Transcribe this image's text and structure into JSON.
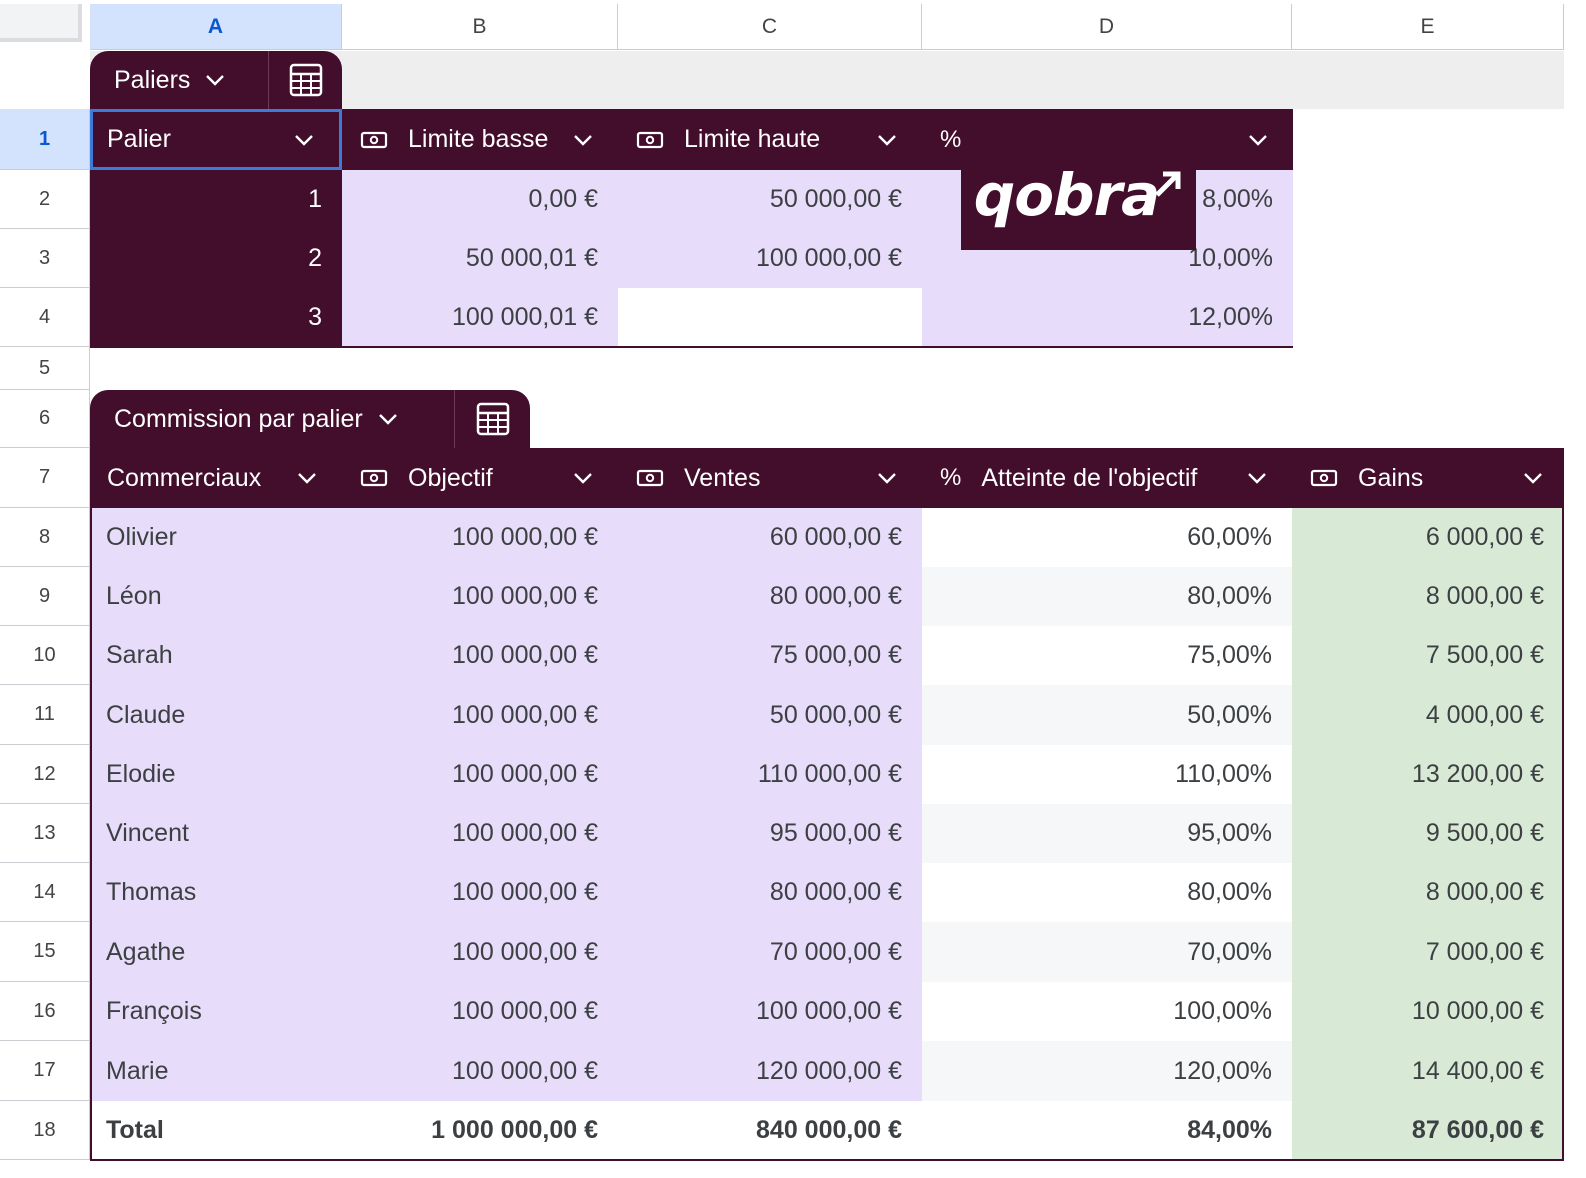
{
  "column_headers": [
    "A",
    "B",
    "C",
    "D",
    "E"
  ],
  "row_headers": [
    "1",
    "2",
    "3",
    "4",
    "5",
    "6",
    "7",
    "8",
    "9",
    "10",
    "11",
    "12",
    "13",
    "14",
    "15",
    "16",
    "17",
    "18"
  ],
  "selected_cell": "A1",
  "brand": {
    "logo_text": "qobra",
    "primary_color": "#420e2b",
    "lavender": "#e7dcf9",
    "green": "#d8ead6",
    "selection_blue": "#d3e3fd"
  },
  "tiers_table": {
    "name": "Paliers",
    "columns": [
      {
        "label": "Palier",
        "icon": ""
      },
      {
        "label": "Limite basse",
        "icon": "money-icon"
      },
      {
        "label": "Limite haute",
        "icon": "money-icon"
      },
      {
        "label": "",
        "icon": "percent-icon"
      }
    ],
    "percent_symbol": "%",
    "rows": [
      {
        "tier": "1",
        "low": "0,00 €",
        "high": "50 000,00 €",
        "rate": "8,00%"
      },
      {
        "tier": "2",
        "low": "50 000,01 €",
        "high": "100 000,00 €",
        "rate": "10,00%"
      },
      {
        "tier": "3",
        "low": "100 000,01 €",
        "high": "",
        "rate": "12,00%"
      }
    ]
  },
  "commission_table": {
    "name": "Commission par palier",
    "percent_symbol": "%",
    "columns": [
      {
        "label": "Commerciaux",
        "icon": ""
      },
      {
        "label": "Objectif",
        "icon": "money-icon"
      },
      {
        "label": "Ventes",
        "icon": "money-icon"
      },
      {
        "label": "Atteinte de l'objectif",
        "icon": "percent-icon"
      },
      {
        "label": "Gains",
        "icon": "money-icon"
      }
    ],
    "rows": [
      {
        "name": "Olivier",
        "target": "100 000,00 €",
        "sales": "60 000,00 €",
        "attainment": "60,00%",
        "earnings": "6 000,00 €"
      },
      {
        "name": "Léon",
        "target": "100 000,00 €",
        "sales": "80 000,00 €",
        "attainment": "80,00%",
        "earnings": "8 000,00 €"
      },
      {
        "name": "Sarah",
        "target": "100 000,00 €",
        "sales": "75 000,00 €",
        "attainment": "75,00%",
        "earnings": "7 500,00 €"
      },
      {
        "name": "Claude",
        "target": "100 000,00 €",
        "sales": "50 000,00 €",
        "attainment": "50,00%",
        "earnings": "4 000,00 €"
      },
      {
        "name": "Elodie",
        "target": "100 000,00 €",
        "sales": "110 000,00 €",
        "attainment": "110,00%",
        "earnings": "13 200,00 €"
      },
      {
        "name": "Vincent",
        "target": "100 000,00 €",
        "sales": "95 000,00 €",
        "attainment": "95,00%",
        "earnings": "9 500,00 €"
      },
      {
        "name": "Thomas",
        "target": "100 000,00 €",
        "sales": "80 000,00 €",
        "attainment": "80,00%",
        "earnings": "8 000,00 €"
      },
      {
        "name": "Agathe",
        "target": "100 000,00 €",
        "sales": "70 000,00 €",
        "attainment": "70,00%",
        "earnings": "7 000,00 €"
      },
      {
        "name": "François",
        "target": "100 000,00 €",
        "sales": "100 000,00 €",
        "attainment": "100,00%",
        "earnings": "10 000,00 €"
      },
      {
        "name": "Marie",
        "target": "100 000,00 €",
        "sales": "120 000,00 €",
        "attainment": "120,00%",
        "earnings": "14 400,00 €"
      }
    ],
    "total": {
      "label": "Total",
      "target": "1 000 000,00 €",
      "sales": "840 000,00 €",
      "attainment": "84,00%",
      "earnings": "87 600,00 €"
    }
  }
}
